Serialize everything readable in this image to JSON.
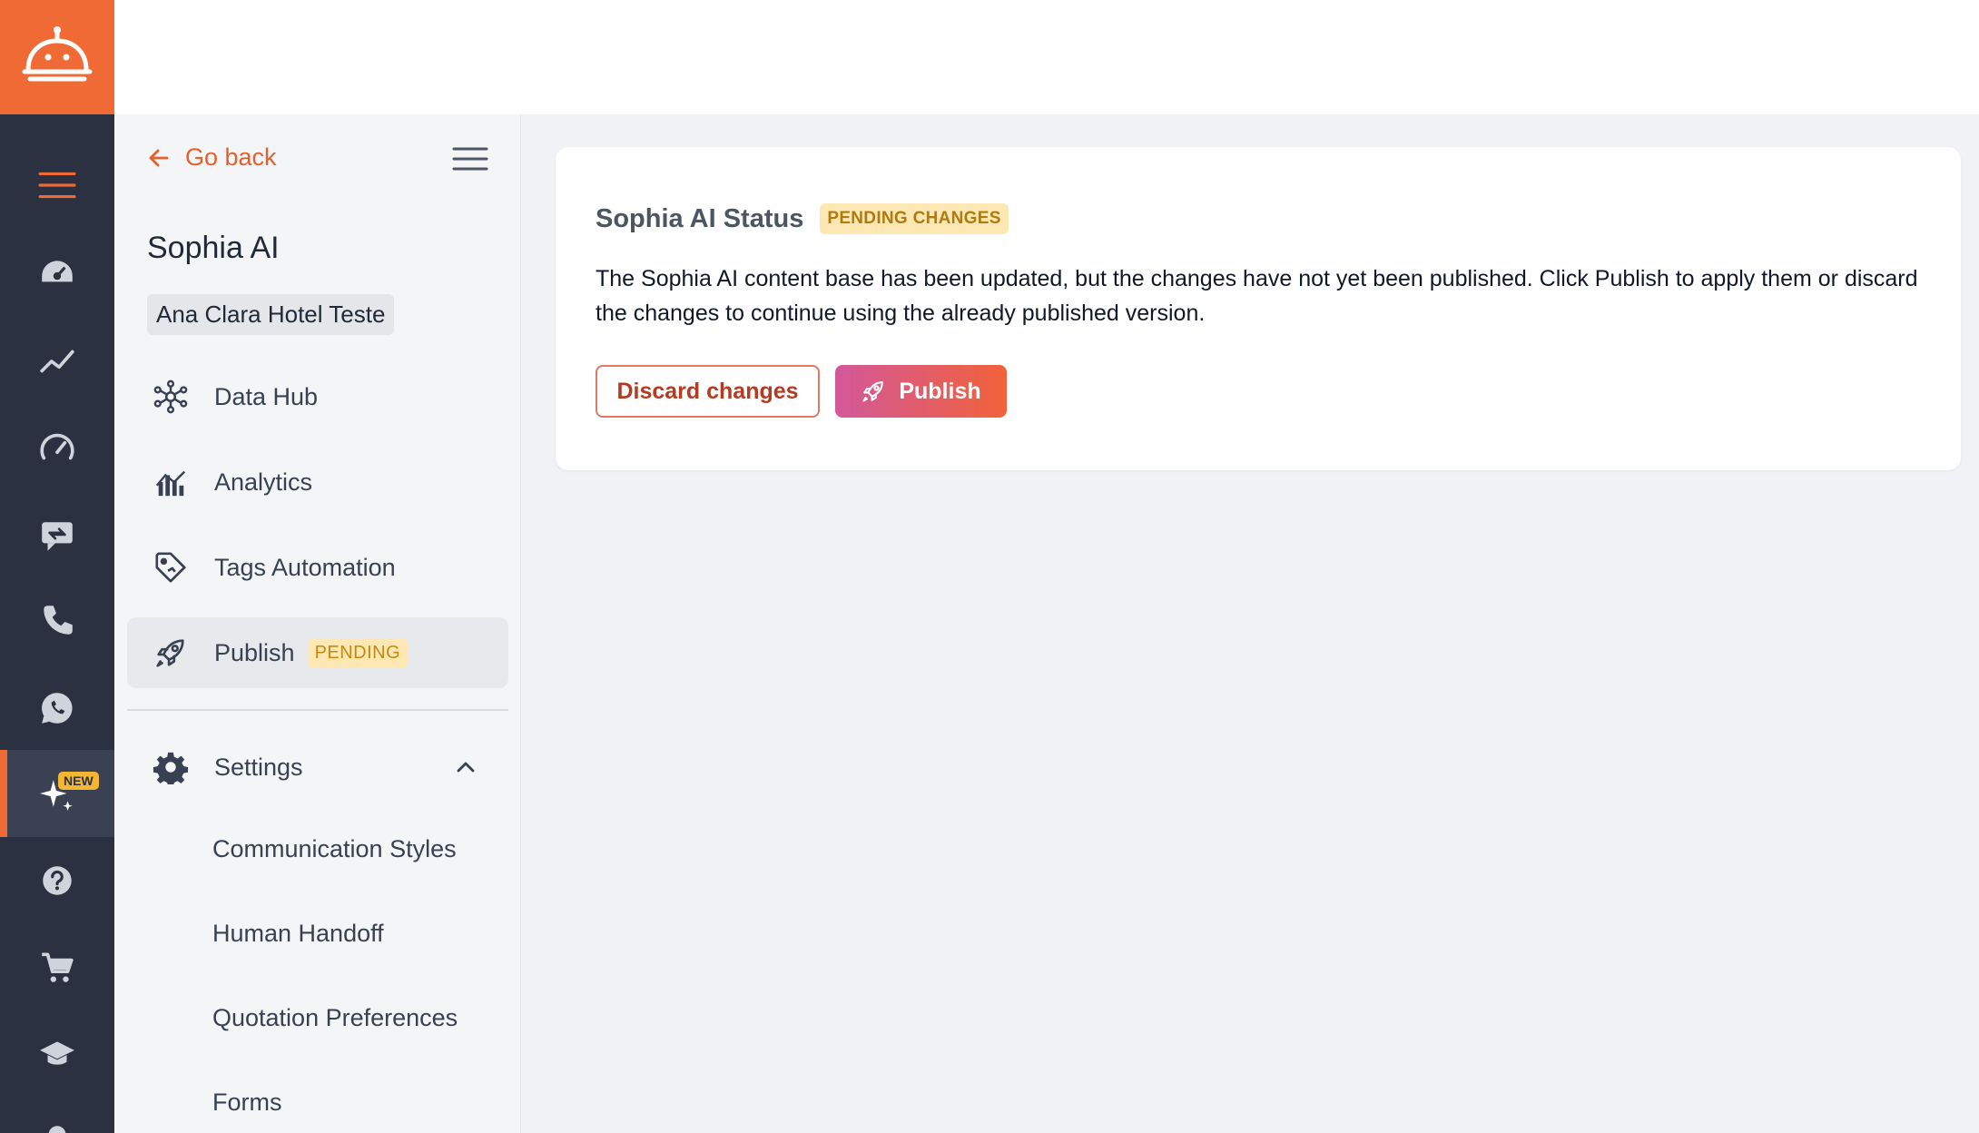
{
  "rail": {
    "new_badge": "NEW",
    "items": [
      "menu-icon",
      "dashboard-icon",
      "trend-icon",
      "speedometer-icon",
      "chat-exchange-icon",
      "phone-icon",
      "whatsapp-icon",
      "sparkle-ai-icon",
      "help-icon",
      "cart-icon",
      "graduation-cap-icon"
    ]
  },
  "sidebar": {
    "go_back": "Go back",
    "title": "Sophia AI",
    "hotel": "Ana Clara Hotel Teste",
    "nav": {
      "data_hub": "Data Hub",
      "analytics": "Analytics",
      "tags_automation": "Tags Automation",
      "publish": "Publish",
      "publish_badge": "PENDING",
      "settings": "Settings"
    },
    "settings_items": {
      "communication_styles": "Communication Styles",
      "human_handoff": "Human Handoff",
      "quotation_preferences": "Quotation Preferences",
      "forms": "Forms"
    }
  },
  "card": {
    "title": "Sophia AI Status",
    "status": "PENDING CHANGES",
    "description": "The Sophia AI content base has been updated, but the changes have not yet been published. Click Publish to apply them or discard the changes to continue using the already published version.",
    "discard_label": "Discard changes",
    "publish_label": "Publish"
  },
  "colors": {
    "brand": "#f06a35",
    "rail_bg": "#2b3140",
    "pending_bg": "#fde8b4",
    "pending_text": "#c8870e"
  }
}
